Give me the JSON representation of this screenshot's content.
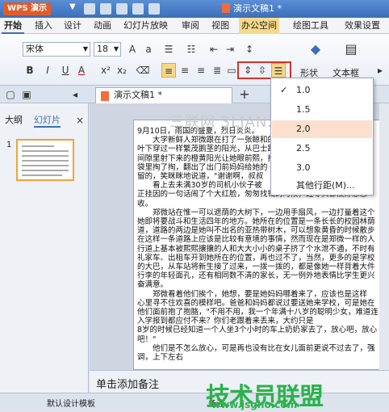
{
  "titlebar": {
    "app_name": "WPS 演示",
    "document_title": "演示文稿1 *"
  },
  "menubar": {
    "items": [
      "开始",
      "插入",
      "设计",
      "动画",
      "幻灯片放映",
      "审阅",
      "视图",
      "办公空间",
      "绘图工具",
      "效果设置"
    ]
  },
  "ribbon": {
    "font_name": "宋体",
    "font_size": "18",
    "shape_label": "形状",
    "textbox_label": "文本框"
  },
  "doc_tab": {
    "label": "演示文稿1 *",
    "add_label": "+"
  },
  "left_pane": {
    "tabs": [
      "大纲",
      "幻灯片"
    ],
    "slide_number": "1"
  },
  "watermark": "三联网 3LIAN.COM",
  "line_spacing_menu": {
    "options": [
      "1.0",
      "1.5",
      "2.0",
      "2.5",
      "3.0",
      "其他行距(M)..."
    ],
    "checked": "1.0",
    "highlighted": "2.0"
  },
  "slide_text": "9月10日，雨国的盛夏，烈日炎炎。\n　　大学新鲜人郑微跟在打了一张鲸和的爷爷身后，在梧桐\n叶下穿过一样繁茂鹅茎的阳光，从巴士跑了下来。抬起头好像\n间隙里射下来的橙黄阳光让她眼前熙，拎着肩是纸\n袋里掏了掏，翻出了出门前妈妈给她的\n留的，笑眯眯地说道，\"谢谢啊，叔叔\n　　看上去未满30岁的司机小伙子被\n正挂因的一句话闹了个大红脸，匆匆找钱的时候，连零头都没好意思收。\n　　郑微站在惟一可以遮荫的大树下，一边用手扇风，一边打量着这个她即将要战斗和生活四年的地方。她所在的位置是一条长长的校园林荫道，道路的两边是她叫不出名的亚热带树木，可以想象黄昏的时候散步在这样一条道路上应该是比较有意境的事情，然而现在是郑微一样的人行道上基本被熙熙攘攘的人和大大小小的桌子挤了个水泄不通，不时有礼家车、出租车开到她所在的位置，再也过不了，当然，更多的是学校的大巴，从车站将新生接了过来，一拨一拨的，都是像她一样背着大件行李的年轻面孔，还有相同数不清的家长，无一例外地表情比学生更兴奋满意。\n　　郑微看着他们挨个，她想，要是她妈妈哪着来了，应该也是这样\n心里寻不住欢喜的模样吧。爸爸和妈妈都说过要送她来学校，可是她在他们面前抱了抱胳，\"不用不用，我一个年满十八岁的聪明少女，难道连入学报到都应付不来？你们老跟着来丢来，大约只是\n8岁的时候已经知道一个人坐3个小时的车上奶奶家去了，放心吧，放心吧！\"\n　　他们是不怎么放心，可是再也没有比在女儿面前更说不过去了，强调，上下左右",
  "notes_placeholder": "单击添加备注",
  "status": {
    "template": "默认设计模板",
    "notes": "备注"
  },
  "brand": {
    "name": "技术员联盟",
    "url": "www.jsgho.com"
  }
}
